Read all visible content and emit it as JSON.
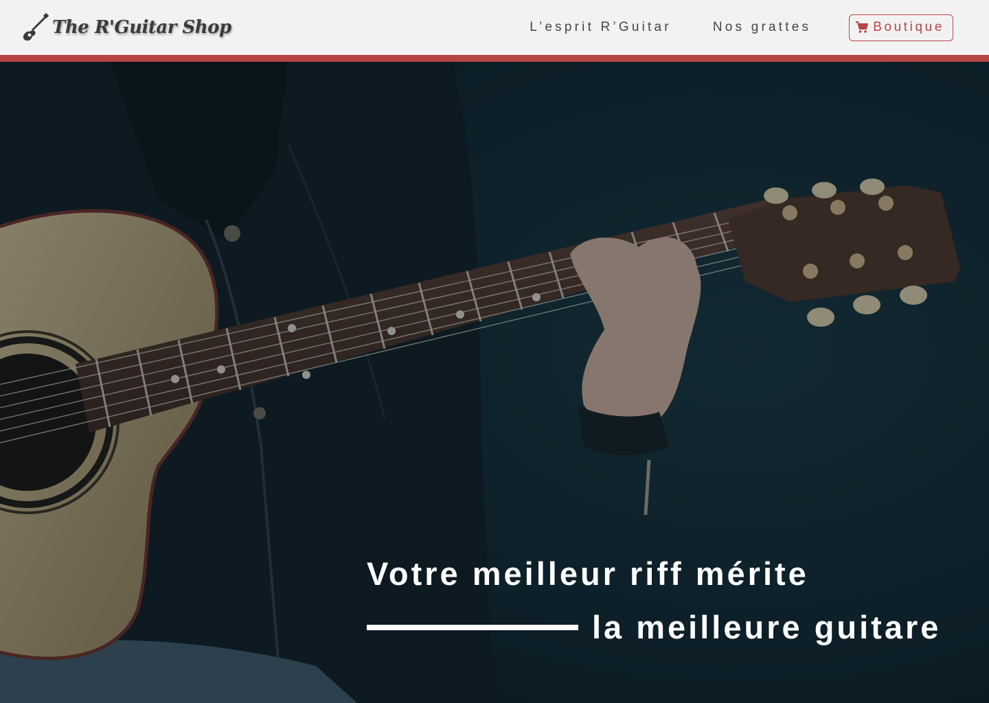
{
  "header": {
    "logo_text": "The R'Guitar Shop",
    "nav": [
      {
        "label": "L’esprit R’Guitar"
      },
      {
        "label": "Nos grattes"
      }
    ],
    "shop_button": {
      "label": "Boutique",
      "icon": "cart-icon"
    }
  },
  "hero": {
    "line1": "Votre meilleur riff mérite",
    "line2": "la meilleure guitare"
  },
  "colors": {
    "accent": "#b84444",
    "header_bg": "#f2f2f2",
    "hero_overlay": "#0b1c24",
    "headline": "#ffffff"
  },
  "icons": {
    "logo": "guitar-icon",
    "shop": "cart-icon"
  }
}
